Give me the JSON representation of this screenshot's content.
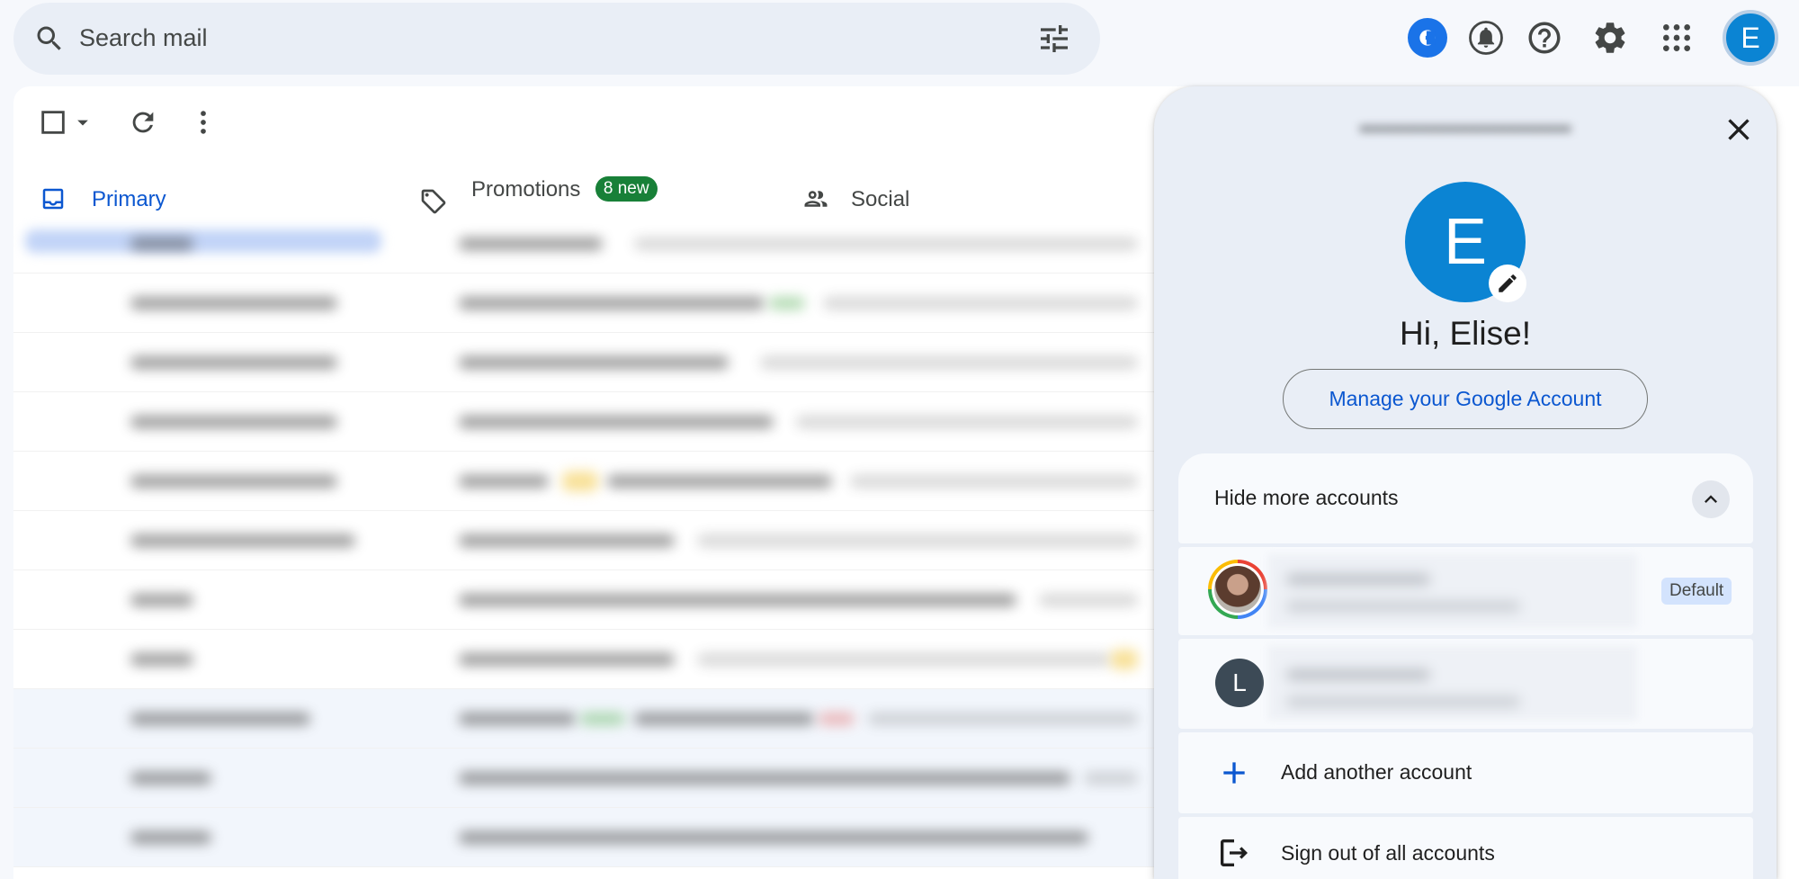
{
  "search": {
    "placeholder": "Search mail"
  },
  "user": {
    "initial": "E"
  },
  "tabs": [
    {
      "label": "Primary"
    },
    {
      "label": "Promotions",
      "badge": "8 new"
    },
    {
      "label": "Social"
    }
  ],
  "colors": {
    "accent": "#0b57d0",
    "avatar": "#0b84d3",
    "badge_green": "#188038",
    "panel_bg": "#e9eef6"
  },
  "icons": {
    "search": "search-icon",
    "tune": "tune-icon",
    "gemini": "gemini-icon",
    "notifications": "bell-icon",
    "help": "help-icon",
    "settings": "gear-icon",
    "apps": "apps-grid-icon",
    "close": "close-icon",
    "edit": "pencil-icon",
    "chevron": "chevron-up-icon",
    "add": "plus-icon",
    "signout": "logout-icon"
  },
  "account_panel": {
    "greeting": "Hi, Elise!",
    "avatar_initial": "E",
    "manage_label": "Manage your Google Account",
    "hide_more_label": "Hide more accounts",
    "default_badge": "Default",
    "second_account_initial": "L",
    "add_account_label": "Add another account",
    "sign_out_label": "Sign out of all accounts"
  }
}
